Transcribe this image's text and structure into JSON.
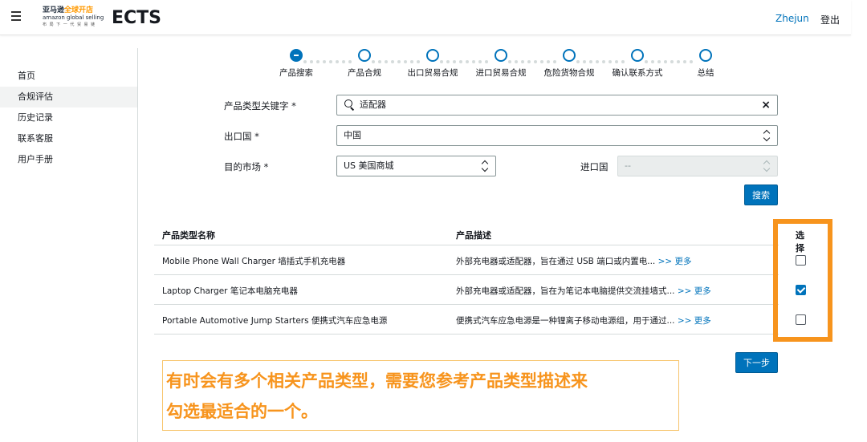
{
  "header": {
    "logo": {
      "line1_a": "亚马逊",
      "line1_b": "全球开店",
      "line2": "amazon global selling",
      "line3": "布 局 下 一 代 贸 易 链"
    },
    "title": "ECTS",
    "user": "Zhejun",
    "logout": "登出"
  },
  "sidebar": {
    "items": [
      {
        "label": "首页",
        "active": false
      },
      {
        "label": "合规评估",
        "active": true
      },
      {
        "label": "历史记录",
        "active": false
      },
      {
        "label": "联系客服",
        "active": false
      },
      {
        "label": "用户手册",
        "active": false
      }
    ]
  },
  "stepper": {
    "steps": [
      "产品搜索",
      "产品合规",
      "出口贸易合规",
      "进口贸易合规",
      "危险货物合规",
      "确认联系方式",
      "总结"
    ],
    "current_index": 0
  },
  "form": {
    "keyword_label": "产品类型关键字 *",
    "keyword_value": "适配器",
    "export_label": "出口国 *",
    "export_value": "中国",
    "market_label": "目的市场 *",
    "market_value": "US 美国商城",
    "import_label": "进口国",
    "import_value": "--",
    "search_button": "搜索"
  },
  "table": {
    "headers": {
      "name": "产品类型名称",
      "desc": "产品描述",
      "select": "选择"
    },
    "more_label": ">> 更多",
    "rows": [
      {
        "name": "Mobile Phone Wall Charger 墙插式手机充电器",
        "desc": "外部充电器或适配器，旨在通过 USB 端口或内置电...",
        "checked": false
      },
      {
        "name": "Laptop Charger 笔记本电脑充电器",
        "desc": "外部充电器或适配器，旨在为笔记本电脑提供交流挂墙式...",
        "checked": true
      },
      {
        "name": "Portable Automotive Jump Starters 便携式汽车应急电源",
        "desc": "便携式汽车应急电源是一种锂离子移动电源组，用于通过...",
        "checked": false
      }
    ]
  },
  "next_button": "下一步",
  "note": {
    "line1": "有时会有多个相关产品类型，需要您参考产品类型描述来",
    "line2": "勾选最适合的一个。"
  },
  "colors": {
    "accent": "#0073bb",
    "highlight": "#f7941d"
  }
}
